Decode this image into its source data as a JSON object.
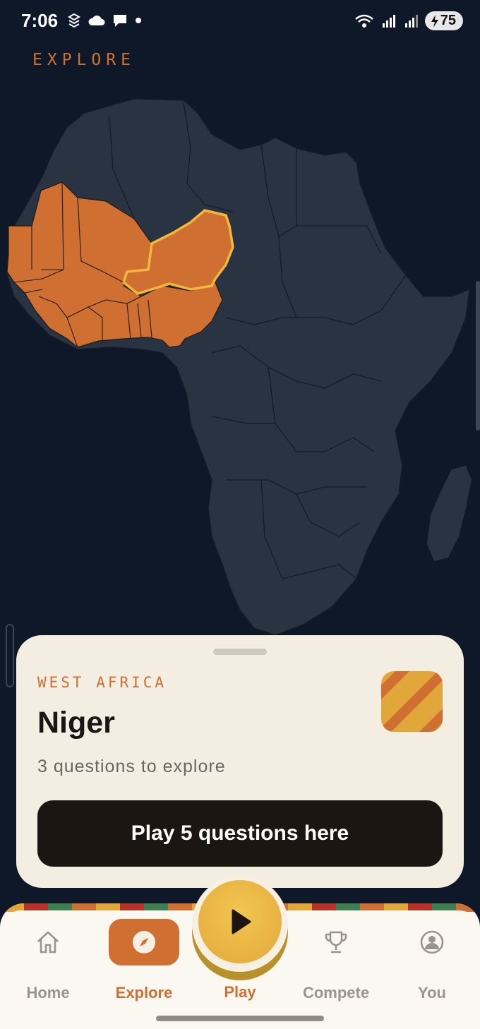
{
  "status_bar": {
    "time": "7:06",
    "battery": "75",
    "left_icons": [
      "notification-stack-icon",
      "cloud-icon",
      "chat-bubble-icon",
      "dot-icon"
    ],
    "right_icons": [
      "wifi-icon",
      "signal-r-icon",
      "signal-icon",
      "battery-charging-icon"
    ]
  },
  "header": {
    "title": "EXPLORE"
  },
  "map": {
    "highlight_color": "#cf6f31",
    "selected_outline_color": "#f1b83c",
    "land_color": "#293342"
  },
  "card": {
    "region": "WEST AFRICA",
    "country": "Niger",
    "subtitle": "3 questions to explore",
    "button_label": "Play 5 questions here",
    "flag_colors": [
      "#e2a73a",
      "#cf6f31"
    ]
  },
  "nav": {
    "items": [
      {
        "label": "Home",
        "icon": "home-icon",
        "active": false
      },
      {
        "label": "Explore",
        "icon": "compass-icon",
        "active": true
      },
      {
        "label": "Play",
        "icon": "play-icon",
        "active": false
      },
      {
        "label": "Compete",
        "icon": "trophy-icon",
        "active": false
      },
      {
        "label": "You",
        "icon": "user-icon",
        "active": false
      }
    ]
  },
  "colors": {
    "accent": "#cf6f31",
    "background": "#0f1829",
    "gold": "#e3a93a"
  }
}
